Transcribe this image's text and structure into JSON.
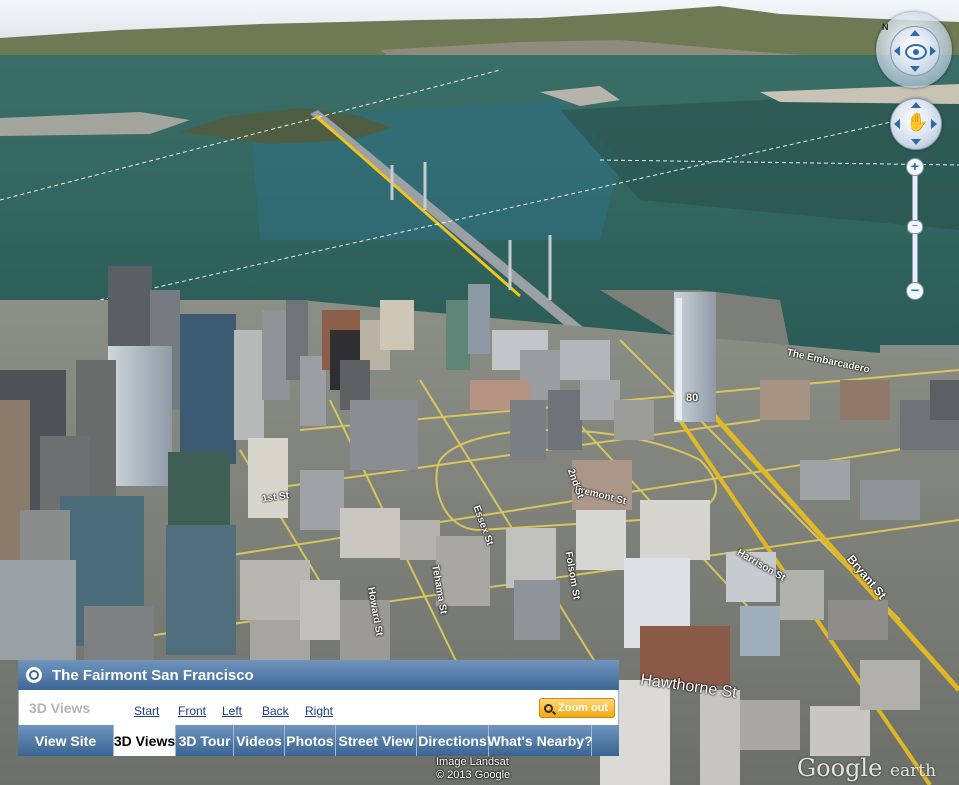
{
  "map": {
    "labels": {
      "embarcadero": "The Embarcadero",
      "interstate": "80",
      "first_st": "1st St",
      "fremont_st": "Fremont St",
      "howard_st": "Howard St",
      "tehama_st": "Tehama St",
      "folsom_st": "Folsom St",
      "hawthorne_st": "Hawthorne St",
      "harrison_st": "Harrison St",
      "bryant_st": "Bryant St",
      "essex_st": "Essex St",
      "second_st": "2nd St"
    },
    "attribution": [
      "Image Landsat",
      "© 2013 Google"
    ],
    "logo": {
      "google": "Google",
      "earth": "earth"
    }
  },
  "nav": {
    "north_label": "N",
    "pan_symbol": "✋",
    "zoom_in": "+",
    "zoom_out": "−",
    "slider": "−"
  },
  "panel": {
    "title": "The Fairmont San Francisco",
    "section": "3D Views",
    "links": [
      "Start",
      "Front",
      "Left",
      "Back",
      "Right"
    ],
    "zoom_out_label": "Zoom out",
    "tabs": [
      "View Site",
      "3D Views",
      "3D Tour",
      "Videos",
      "Photos",
      "Street View",
      "Directions",
      "What's Nearby?"
    ],
    "active_tab": "3D Views"
  },
  "colors": {
    "water": "#2d6a66",
    "panel_header": "#4a74a2",
    "road": "#f2c318",
    "zoom_button": "#f2a813"
  }
}
